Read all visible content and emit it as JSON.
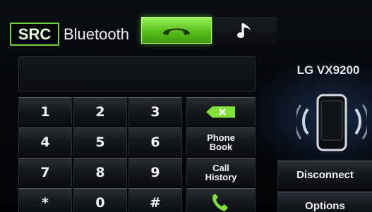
{
  "top_bar": {
    "src_label": "SRC",
    "mode_title": "Bluetooth",
    "tabs": [
      {
        "name": "phone",
        "icon": "phone-handset-icon",
        "active": true
      },
      {
        "name": "music",
        "icon": "music-note-icon",
        "active": false
      }
    ]
  },
  "dialer": {
    "number_value": "",
    "keys": [
      "1",
      "2",
      "3",
      "4",
      "5",
      "6",
      "7",
      "8",
      "9",
      "*",
      "0",
      "#"
    ],
    "functions": {
      "backspace_icon": "backspace-icon",
      "phone_book_line1": "Phone",
      "phone_book_line2": "Book",
      "call_history_line1": "Call",
      "call_history_line2": "History",
      "call_icon": "call-icon"
    }
  },
  "device": {
    "name": "LG VX9200",
    "icon": "bluetooth-phone-icon",
    "disconnect_label": "Disconnect",
    "options_label": "Options"
  },
  "colors": {
    "accent_green": "#6fd63a",
    "button_dark": "#15181c",
    "text": "#ffffff"
  }
}
